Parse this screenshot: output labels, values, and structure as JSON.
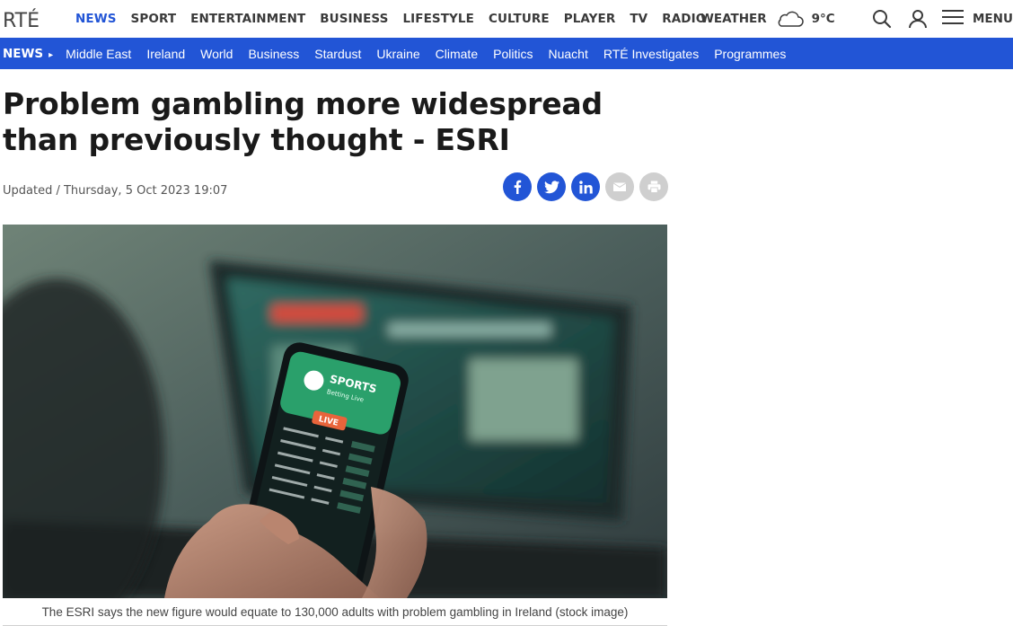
{
  "brand": {
    "logo_text": "RTÉ"
  },
  "main_nav": [
    "NEWS",
    "SPORT",
    "ENTERTAINMENT",
    "BUSINESS",
    "LIFESTYLE",
    "CULTURE",
    "PLAYER",
    "TV",
    "RADIO"
  ],
  "main_nav_active": "NEWS",
  "weather": {
    "label": "WEATHER",
    "icon": "cloud-icon",
    "temp": "9°C"
  },
  "tools": {
    "search_icon": "search-icon",
    "account_icon": "account-icon",
    "menu_icon": "hamburger-icon",
    "menu_label": "MENU"
  },
  "sub_nav": {
    "section": "NEWS",
    "arrow": "▸",
    "items": [
      "Middle East",
      "Ireland",
      "World",
      "Business",
      "Stardust",
      "Ukraine",
      "Climate",
      "Politics",
      "Nuacht",
      "RTÉ Investigates",
      "Programmes"
    ]
  },
  "article": {
    "headline": "Problem gambling more widespread than previously thought - ESRI",
    "updated": "Updated / Thursday, 5 Oct 2023 19:07",
    "share_icons": [
      "facebook-icon",
      "twitter-icon",
      "linkedin-icon",
      "email-icon",
      "print-icon"
    ],
    "image_caption": "The ESRI says the new figure would equate to 130,000 adults with problem gambling in Ireland (stock image)",
    "phone_screen_text": {
      "brand": "SPORTS",
      "sub": "Betting Live",
      "badge": "LIVE"
    }
  },
  "colors": {
    "accent": "#2255d6",
    "text": "#1a1a1a",
    "nav_text": "#3a3a3a",
    "share_grey": "#cfcfcf"
  }
}
